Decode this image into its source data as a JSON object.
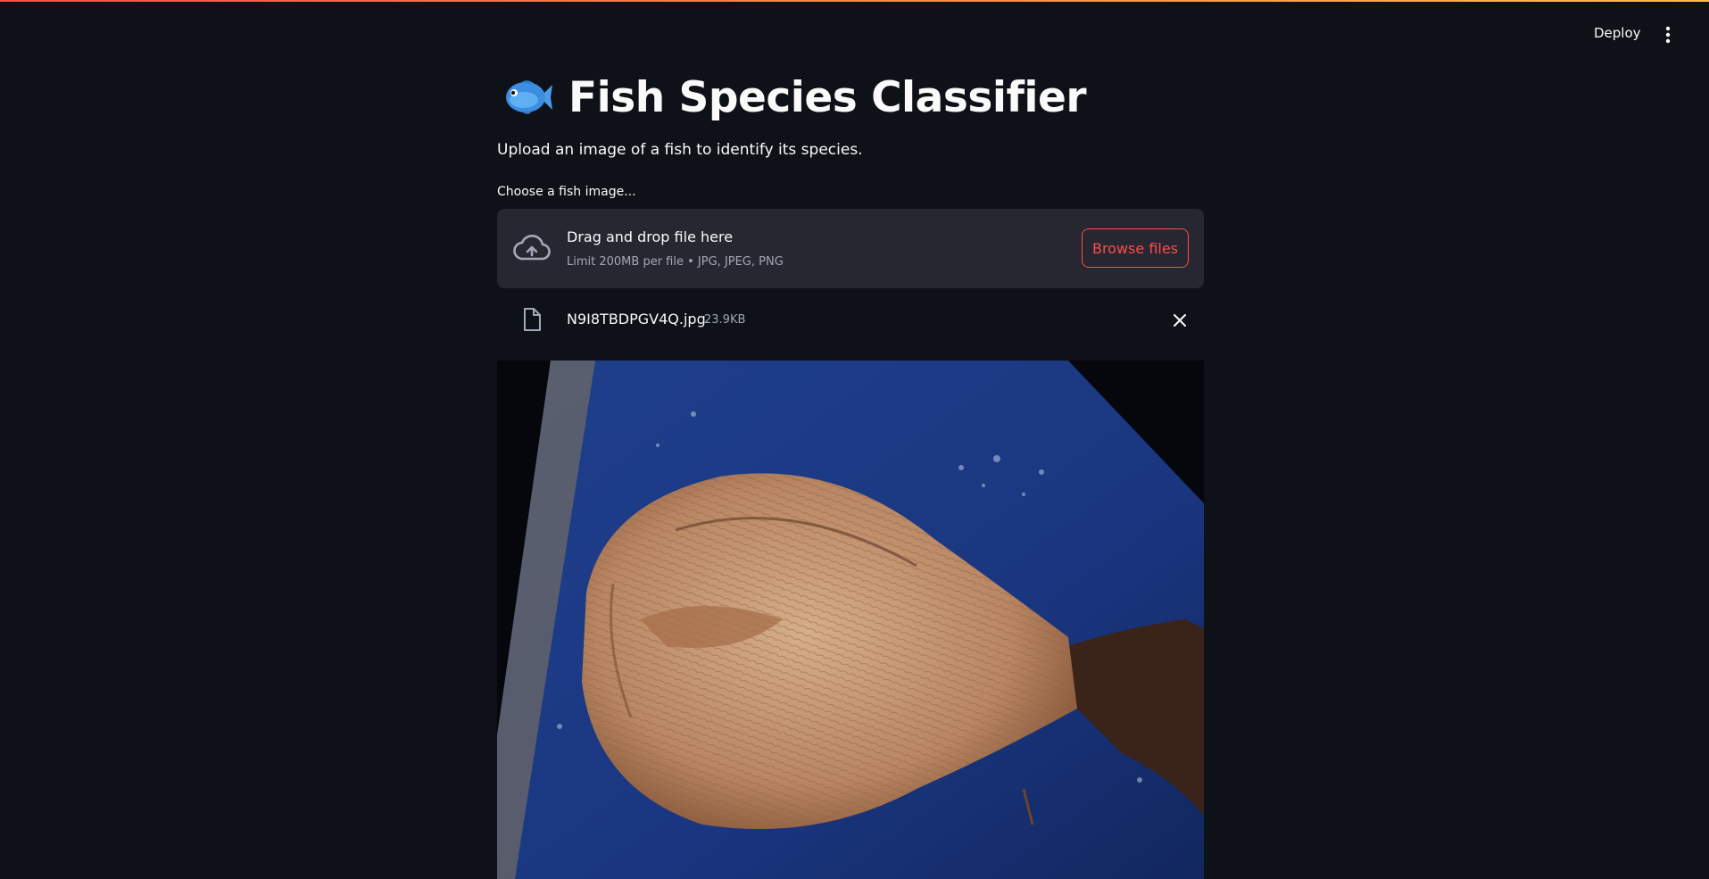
{
  "header": {
    "deploy_label": "Deploy",
    "menu_icon": "vertical-ellipsis-icon"
  },
  "page": {
    "title_emoji": "fish-icon",
    "title": "Fish Species Classifier",
    "subtitle": "Upload an image of a fish to identify its species."
  },
  "uploader": {
    "label": "Choose a fish image...",
    "icon": "cloud-upload-icon",
    "drop_title": "Drag and drop file here",
    "limit_text": "Limit 200MB per file • JPG, JPEG, PNG",
    "browse_label": "Browse files"
  },
  "uploaded_file": {
    "icon": "file-icon",
    "name": "N9I8TBDPGV4Q.jpg",
    "size": "23.9KB",
    "remove_icon": "close-icon"
  },
  "colors": {
    "background": "#0e1117",
    "surface": "#262730",
    "accent": "#ff4b4b",
    "muted_text": "#a3a8b8"
  }
}
